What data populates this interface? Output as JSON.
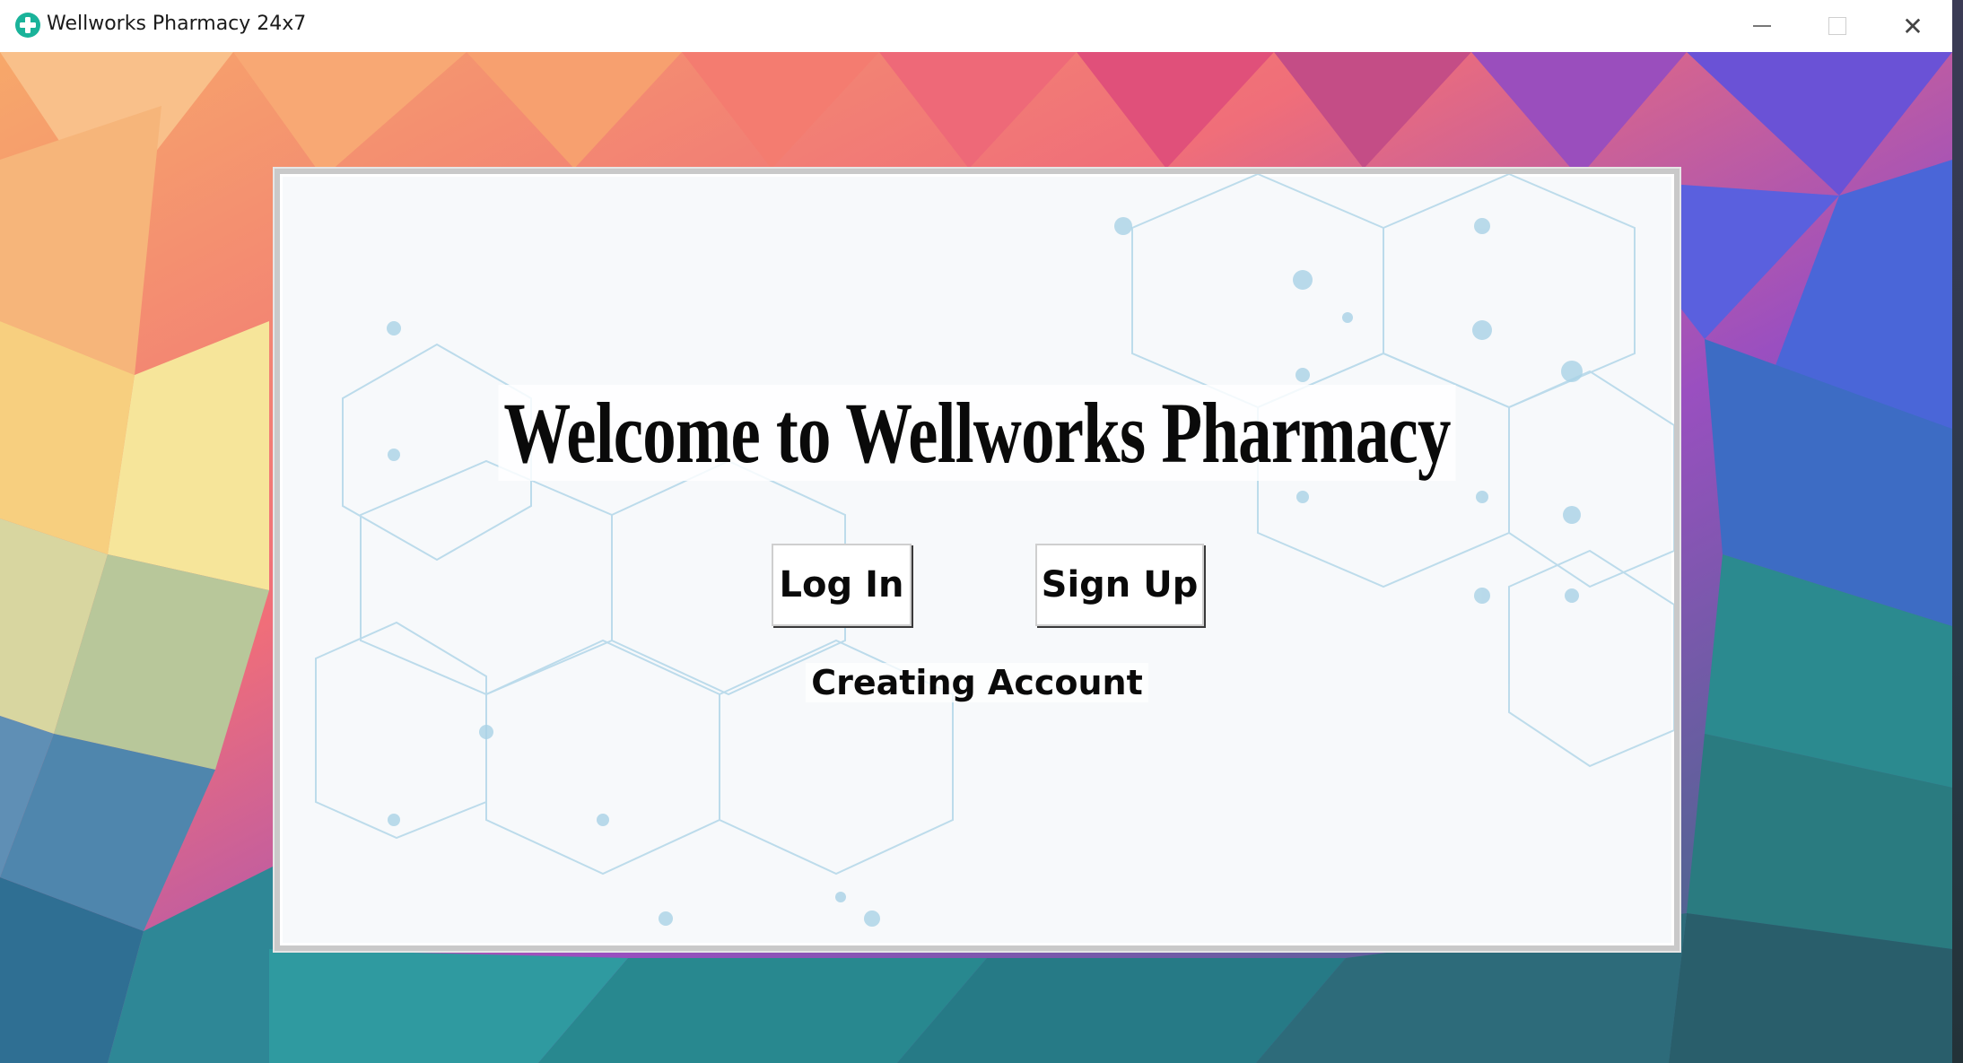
{
  "window": {
    "title": "Wellworks Pharmacy 24x7",
    "icon": "pharmacy-plus-icon",
    "controls": {
      "minimize_icon": "minimize-icon",
      "maximize_icon": "maximize-icon",
      "close_icon": "close-icon",
      "close_glyph": "✕"
    }
  },
  "panel": {
    "heading": "Welcome to Wellworks Pharmacy",
    "login_label": "Log In",
    "signup_label": "Sign Up",
    "status_text": "Creating Account"
  },
  "colors": {
    "accent_icon": "#1ab39a",
    "panel_bg": "#f7f9fb",
    "hex_lines": "#a9d2e6"
  }
}
